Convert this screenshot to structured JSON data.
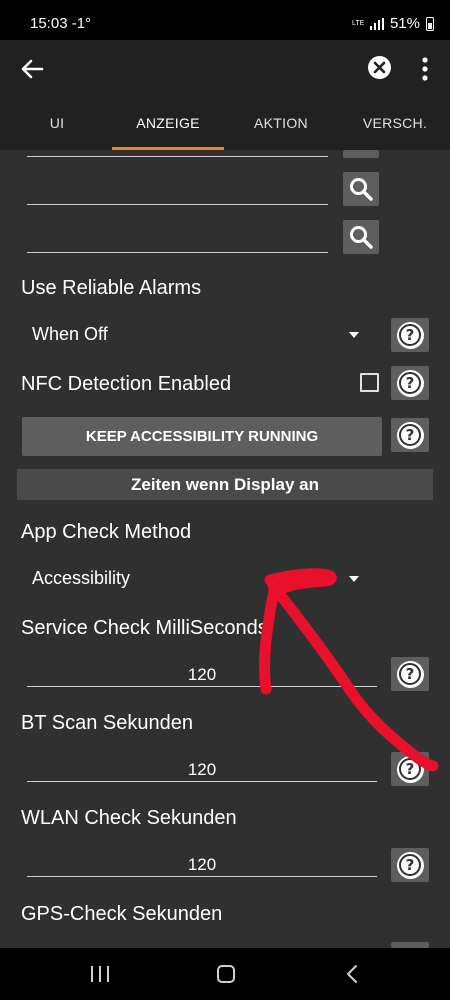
{
  "status": {
    "time": "15:03",
    "temp": "-1°",
    "network": "LTE",
    "battery": "51%"
  },
  "tabs": [
    "UI",
    "ANZEIGE",
    "AKTION",
    "VERSCH."
  ],
  "active_tab": "ANZEIGE",
  "settings": {
    "reliable_alarms": {
      "label": "Use Reliable Alarms",
      "value": "When Off"
    },
    "nfc": {
      "label": "NFC Detection Enabled",
      "checked": false
    },
    "keep_accessibility_button": "KEEP ACCESSIBILITY RUNNING",
    "section_display_on": "Zeiten wenn Display an",
    "app_check": {
      "label": "App Check Method",
      "value": "Accessibility"
    },
    "service_check": {
      "label": "Service Check MilliSeconds",
      "value": "120"
    },
    "bt_scan": {
      "label": "BT Scan Sekunden",
      "value": "120"
    },
    "wlan_check": {
      "label": "WLAN Check Sekunden",
      "value": "120"
    },
    "gps_check": {
      "label": "GPS-Check Sekunden"
    }
  },
  "icons": {
    "back": "arrow-left-icon",
    "clear": "close-circle-icon",
    "menu": "more-vert-icon",
    "search": "search-icon",
    "help": "help-circle-icon",
    "dropdown": "chevron-down-icon"
  },
  "colors": {
    "background": "#303030",
    "appbar": "#212121",
    "tab_indicator": "#f5841f",
    "button": "#5e5e5e",
    "annotation_arrow": "#e8102a"
  }
}
